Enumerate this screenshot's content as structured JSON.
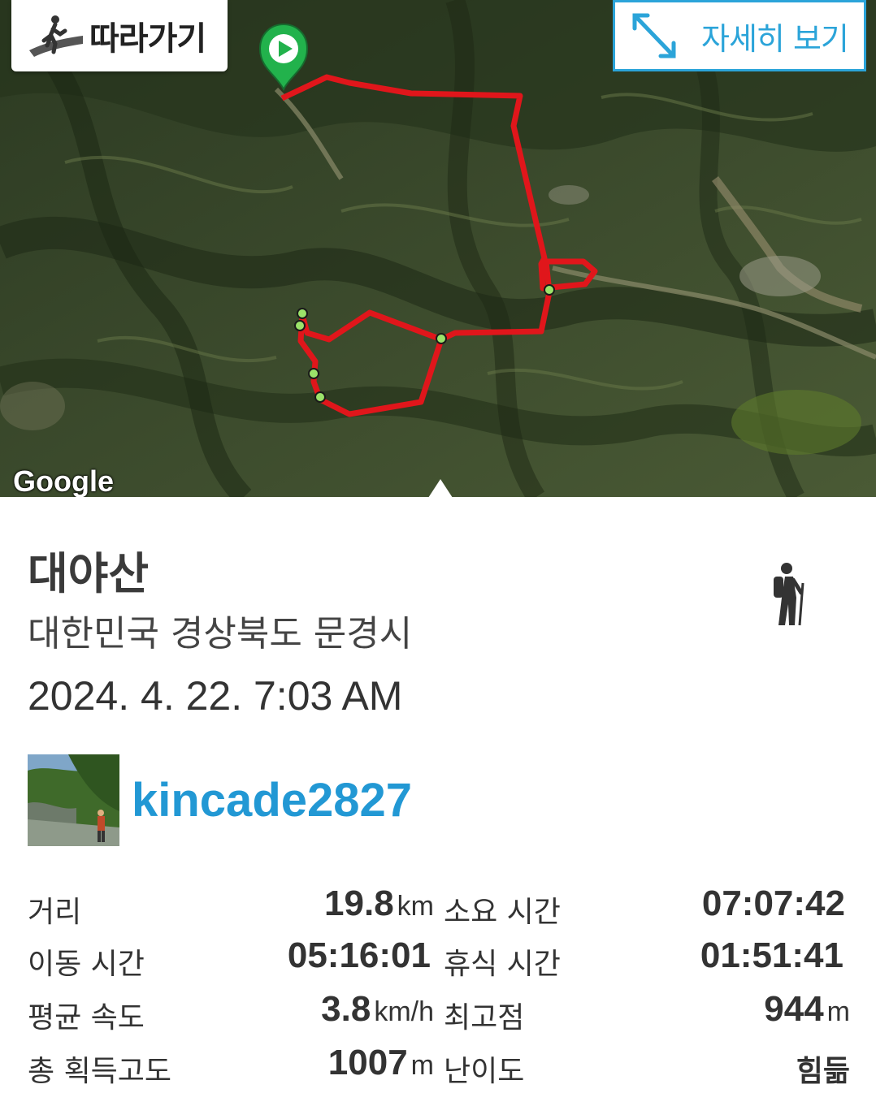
{
  "map": {
    "follow_label": "따라가기",
    "detail_label": "자세히 보기",
    "attribution": "Google",
    "route_color": "#e0161b",
    "start_marker_color": "#22b24c"
  },
  "track": {
    "name": "대야산",
    "location": "대한민국 경상북도 문경시",
    "datetime": "2024. 4. 22. 7:03 AM",
    "activity_icon": "hiking-icon"
  },
  "user": {
    "name": "kincade2827"
  },
  "stats": {
    "distance": {
      "label": "거리",
      "value": "19.8",
      "unit": "km"
    },
    "total_time": {
      "label": "소요 시간",
      "value": "07:07:42"
    },
    "moving_time": {
      "label": "이동 시간",
      "value": "05:16:01"
    },
    "rest_time": {
      "label": "휴식 시간",
      "value": "01:51:41"
    },
    "avg_speed": {
      "label": "평균 속도",
      "value": "3.8",
      "unit": "km/h"
    },
    "max_elev": {
      "label": "최고점",
      "value": "944",
      "unit": "m"
    },
    "elev_gain": {
      "label": "총 획득고도",
      "value": "1007",
      "unit": "m"
    },
    "difficulty": {
      "label": "난이도",
      "value": "힘듦"
    }
  }
}
